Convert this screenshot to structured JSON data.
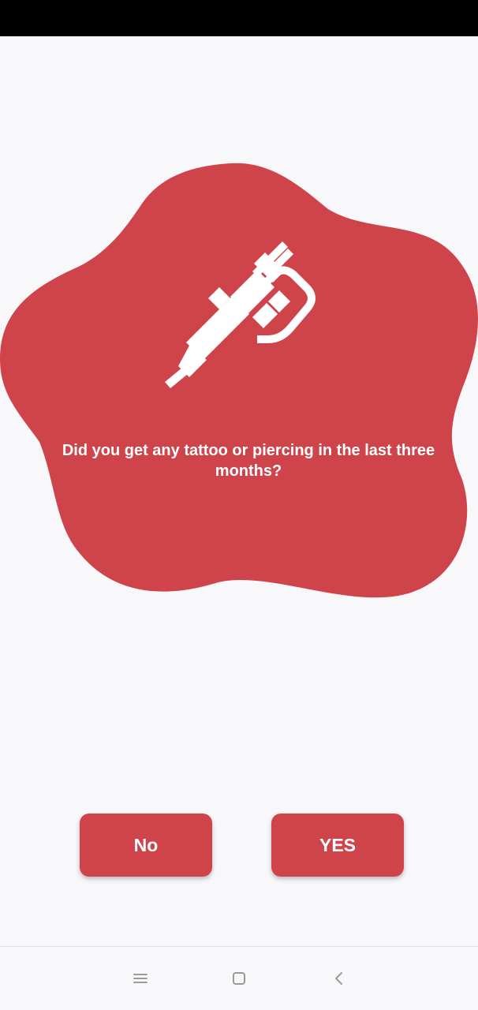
{
  "colors": {
    "accent": "#cf444b",
    "background": "#f8f8fa",
    "status_bar": "#000000",
    "text_on_accent": "#ffffff",
    "nav_icon": "#9a9a9a"
  },
  "question": {
    "icon": "tattoo-machine-icon",
    "text": "Did you get any tattoo or piercing in the last three months?"
  },
  "buttons": {
    "no_label": "No",
    "yes_label": "YES"
  },
  "nav": {
    "menu_icon": "menu-icon",
    "home_icon": "home-square-icon",
    "back_icon": "back-chevron-icon"
  }
}
